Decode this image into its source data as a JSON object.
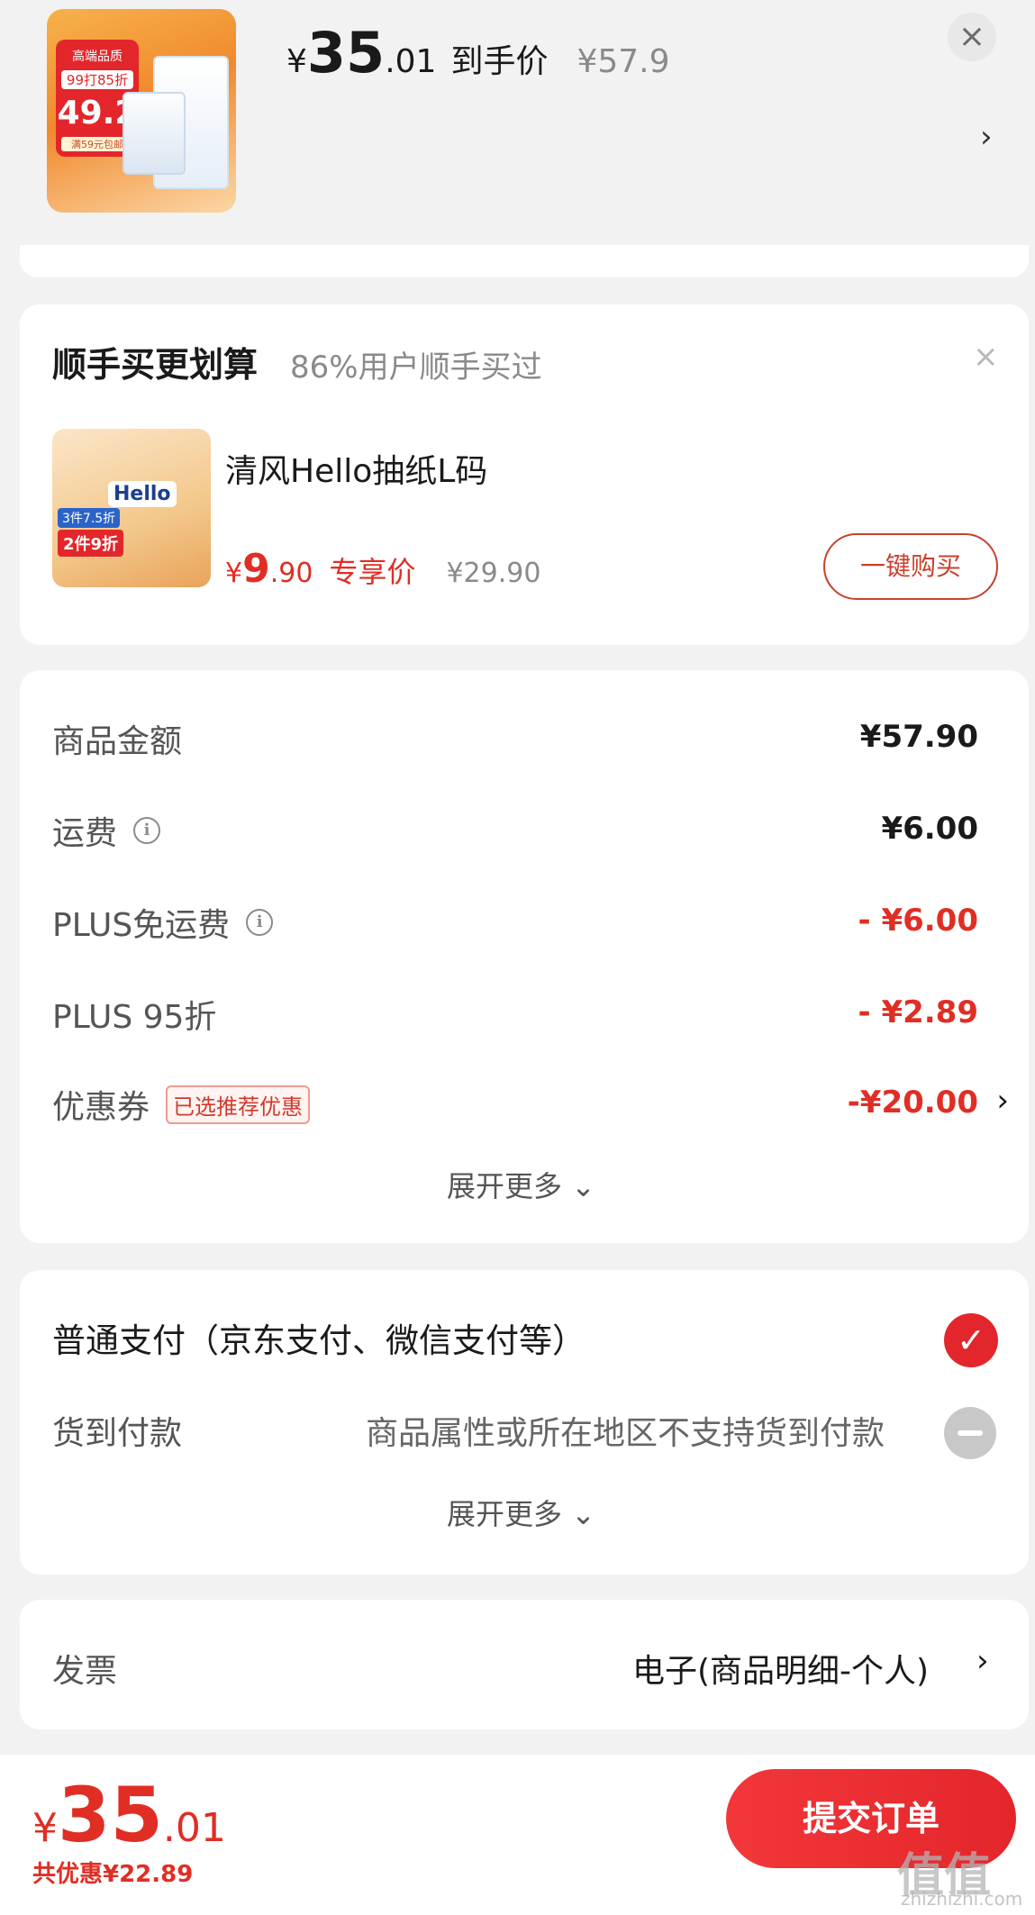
{
  "top_product": {
    "price_yen": "¥",
    "price_int": "35",
    "price_dec": ".01",
    "price_label": "到手价",
    "original_price": "¥57.9",
    "thumb_badge_title": "高端品质",
    "thumb_badge_promo": "99打85折",
    "thumb_badge_price": "49.2",
    "thumb_badge_note": "满59元包邮",
    "close_icon": "close-icon",
    "chevron_icon": "chevron-right-icon"
  },
  "recommend": {
    "title": "顺手买更划算",
    "subtitle": "86%用户顺手买过",
    "close_icon": "close-icon",
    "image_label": "Hello",
    "image_tag": "2件9折",
    "image_tag2": "3件7.5折",
    "product_name": "清风Hello抽纸L码",
    "price_yen": "¥",
    "price_int": "9",
    "price_dec": ".90",
    "price_tag": "专享价",
    "original_price": "¥29.90",
    "buy_button": "一键购买"
  },
  "amount": {
    "rows": [
      {
        "label": "商品金额",
        "value": "¥57.90"
      },
      {
        "label": "运费",
        "value": "¥6.00"
      },
      {
        "label": "PLUS免运费",
        "value": "- ¥6.00"
      },
      {
        "label": "PLUS 95折",
        "value": "- ¥2.89"
      },
      {
        "label": "优惠券",
        "badge": "已选推荐优惠",
        "value": "-¥20.00"
      }
    ],
    "expand_more": "展开更多 ⌄"
  },
  "payment": {
    "normal": "普通支付（京东支付、微信支付等）",
    "cod_label": "货到付款",
    "cod_note": "商品属性或所在地区不支持货到付款",
    "expand_more": "展开更多 ⌄"
  },
  "invoice": {
    "label": "发票",
    "value": "电子(商品明细-个人)"
  },
  "bottom": {
    "price_yen": "¥",
    "price_int": "35",
    "price_dec": ".01",
    "discount": "共优惠¥22.89",
    "submit": "提交订单"
  },
  "watermark": {
    "text": "值值值",
    "sub": "zhizhizhi.com"
  },
  "colors": {
    "accent_red": "#e02e24",
    "button_red": "#e3262b",
    "background": "#f2f2f2"
  }
}
